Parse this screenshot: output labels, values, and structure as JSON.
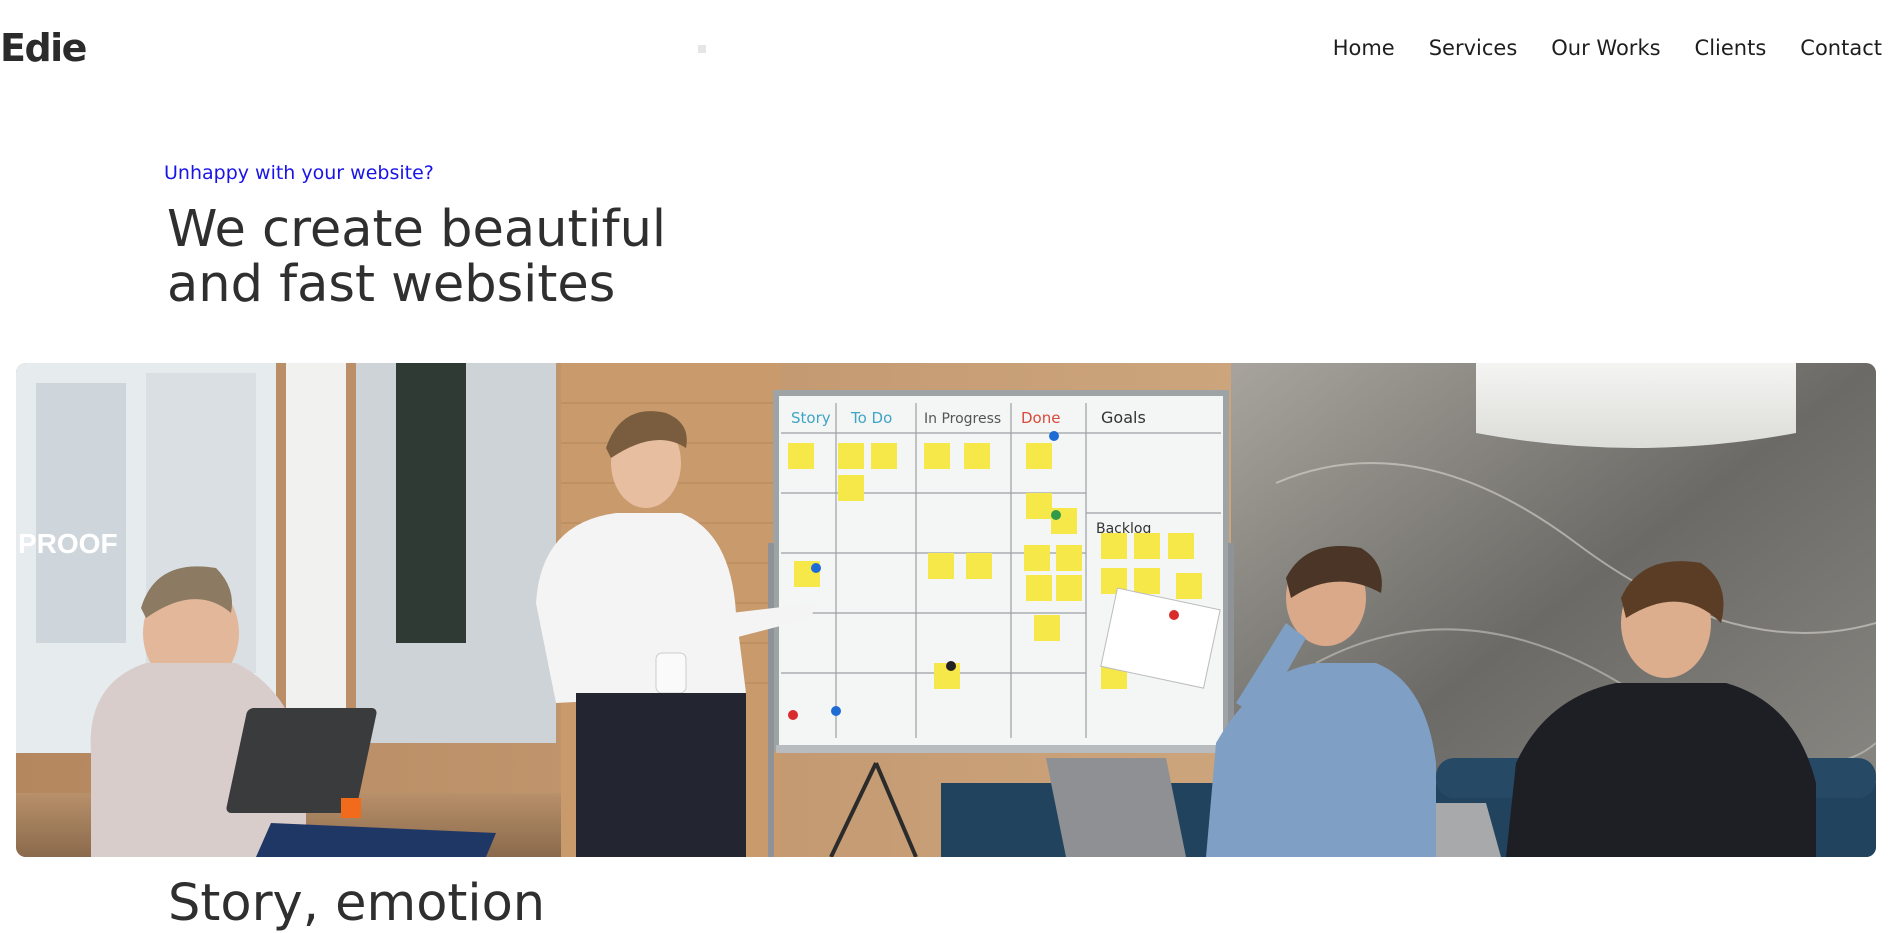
{
  "brand": {
    "logo_text": "Edie"
  },
  "nav": {
    "items": [
      {
        "label": "Home"
      },
      {
        "label": "Services"
      },
      {
        "label": "Our Works"
      },
      {
        "label": "Clients"
      },
      {
        "label": "Contact"
      }
    ]
  },
  "hero": {
    "eyebrow": "Unhappy with your website?",
    "title_line1": "We create beautiful",
    "title_line2": "and fast websites"
  },
  "image": {
    "board_headers": [
      "Story",
      "To Do",
      "In Progress",
      "Done",
      "Goals"
    ],
    "board_backlog": "Backlog",
    "window_text": "PROOF"
  },
  "section": {
    "title": "Story, emotion"
  },
  "colors": {
    "accent": "#1a14e6",
    "heading": "#2f2f2f",
    "sticky_note": "#f7e84a"
  }
}
